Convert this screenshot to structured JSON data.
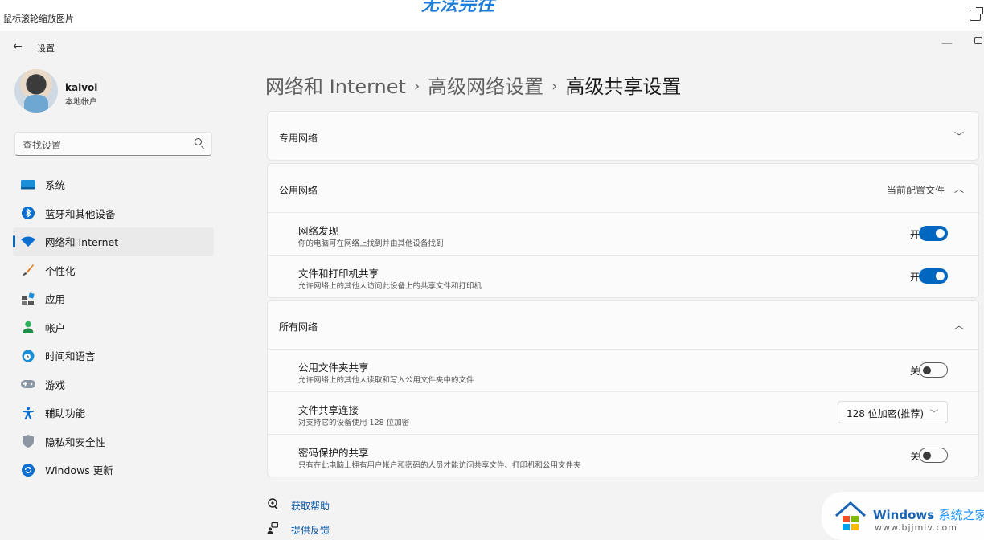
{
  "viewer": {
    "title": "鼠标滚轮缩放图片",
    "overlay_text": "无法完往",
    "popout_icon": "popout-icon"
  },
  "window": {
    "back_icon": "back-arrow-icon",
    "title": "设置",
    "minimize_glyph": "—"
  },
  "profile": {
    "name": "kalvol",
    "account_type": "本地帐户"
  },
  "search": {
    "placeholder": "查找设置"
  },
  "sidebar": {
    "items": [
      {
        "label": "系统",
        "icon": "system-icon",
        "active": false
      },
      {
        "label": "蓝牙和其他设备",
        "icon": "bluetooth-icon",
        "active": false
      },
      {
        "label": "网络和 Internet",
        "icon": "wifi-icon",
        "active": true
      },
      {
        "label": "个性化",
        "icon": "brush-icon",
        "active": false
      },
      {
        "label": "应用",
        "icon": "apps-icon",
        "active": false
      },
      {
        "label": "帐户",
        "icon": "account-icon",
        "active": false
      },
      {
        "label": "时间和语言",
        "icon": "globe-clock-icon",
        "active": false
      },
      {
        "label": "游戏",
        "icon": "gamepad-icon",
        "active": false
      },
      {
        "label": "辅助功能",
        "icon": "accessibility-icon",
        "active": false
      },
      {
        "label": "隐私和安全性",
        "icon": "shield-icon",
        "active": false
      },
      {
        "label": "Windows 更新",
        "icon": "update-icon",
        "active": false
      }
    ]
  },
  "breadcrumb": {
    "level1": "网络和 Internet",
    "level2": "高级网络设置",
    "current": "高级共享设置",
    "separator": "›"
  },
  "sections": {
    "private": {
      "title": "专用网络",
      "expanded": false
    },
    "public": {
      "title": "公用网络",
      "note": "当前配置文件",
      "expanded": true,
      "rows": [
        {
          "title": "网络发现",
          "desc": "你的电脑可在网络上找到并由其他设备找到",
          "state": "开",
          "on": true
        },
        {
          "title": "文件和打印机共享",
          "desc": "允许网络上的其他人访问此设备上的共享文件和打印机",
          "state": "开",
          "on": true
        }
      ]
    },
    "all": {
      "title": "所有网络",
      "expanded": true,
      "rows": [
        {
          "title": "公用文件夹共享",
          "desc": "允许网络上的其他人读取和写入公用文件夹中的文件",
          "state": "关",
          "on": false
        },
        {
          "title": "文件共享连接",
          "desc": "对支持它的设备使用 128 位加密",
          "dropdown_value": "128 位加密(推荐)"
        },
        {
          "title": "密码保护的共享",
          "desc": "只有在此电脑上拥有用户帐户和密码的人员才能访问共享文件、打印机和公用文件夹",
          "state": "关",
          "on": false
        }
      ]
    }
  },
  "help": {
    "get_help": "获取帮助",
    "feedback": "提供反馈"
  },
  "watermark": {
    "brand": "Windows",
    "brand_suffix": "系统之家",
    "url": "www.bjjmlv.com"
  },
  "colors": {
    "accent": "#0067c0",
    "link": "#0a57a6",
    "background": "#f3f3f3",
    "card": "#fbfbfb"
  }
}
